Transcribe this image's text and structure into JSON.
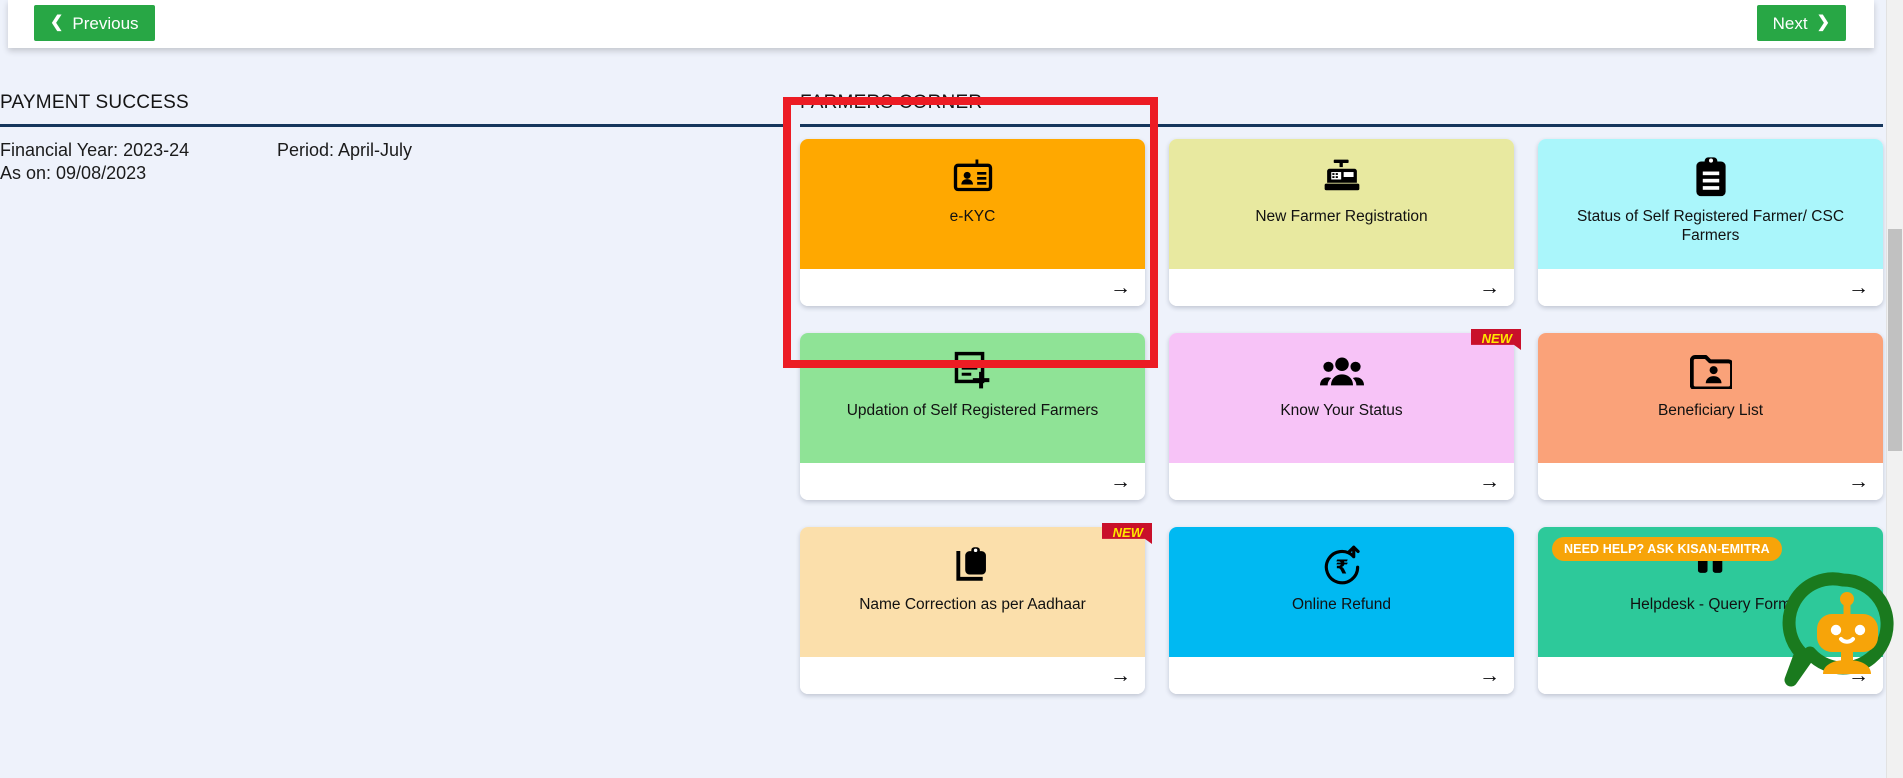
{
  "nav": {
    "previous_label": "Previous",
    "next_label": "Next",
    "prev_icon": "chevron-left-icon",
    "next_icon": "chevron-right-icon"
  },
  "payment": {
    "title": "PAYMENT SUCCESS",
    "financial_year": "Financial Year: 2023-24",
    "as_on": "As on: 09/08/2023",
    "period": "Period: April-July"
  },
  "farmers_corner": {
    "title": "FARMERS CORNER",
    "accent_rule_color": "#16365c",
    "highlight_color": "#ec1c24",
    "tiles": [
      {
        "label": "e-KYC",
        "color": "#ffa800",
        "icon": "id-card-icon",
        "badge": null,
        "arrow": "arrow-right-icon",
        "highlighted": true
      },
      {
        "label": "New Farmer Registration",
        "color": "#e8e9a0",
        "icon": "cash-register-icon",
        "badge": null,
        "arrow": "arrow-right-icon",
        "highlighted": false
      },
      {
        "label": "Status of Self Registered Farmer/ CSC Farmers",
        "color": "#aaf6fb",
        "icon": "clipboard-list-icon",
        "badge": null,
        "arrow": "arrow-right-icon",
        "highlighted": false
      },
      {
        "label": "Updation of Self Registered Farmers",
        "color": "#8fe396",
        "icon": "document-plus-icon",
        "badge": null,
        "arrow": "arrow-right-icon",
        "highlighted": false
      },
      {
        "label": "Know Your Status",
        "color": "#f7c3f7",
        "icon": "people-group-icon",
        "badge": "NEW",
        "arrow": "arrow-right-icon",
        "highlighted": false
      },
      {
        "label": "Beneficiary List",
        "color": "#faa279",
        "icon": "folder-user-icon",
        "badge": null,
        "arrow": "arrow-right-icon",
        "highlighted": false
      },
      {
        "label": "Name Correction as per Aadhaar",
        "color": "#fbdfab",
        "icon": "clipboard-name-icon",
        "badge": "NEW",
        "arrow": "arrow-right-icon",
        "highlighted": false
      },
      {
        "label": "Online Refund",
        "color": "#00b9f2",
        "icon": "rupee-refund-icon",
        "badge": null,
        "arrow": "arrow-right-icon",
        "highlighted": false
      },
      {
        "label": "Helpdesk - Query Form",
        "color": "#2dc99a",
        "icon": "quote-icon",
        "badge": null,
        "arrow": "arrow-right-icon",
        "highlighted": false
      }
    ]
  },
  "chatbot": {
    "tooltip": "NEED HELP? ASK KISAN-EMITRA",
    "icon": "chatbot-robot-icon",
    "bubble_color": "#1a7a1e",
    "robot_color": "#f7a409"
  }
}
